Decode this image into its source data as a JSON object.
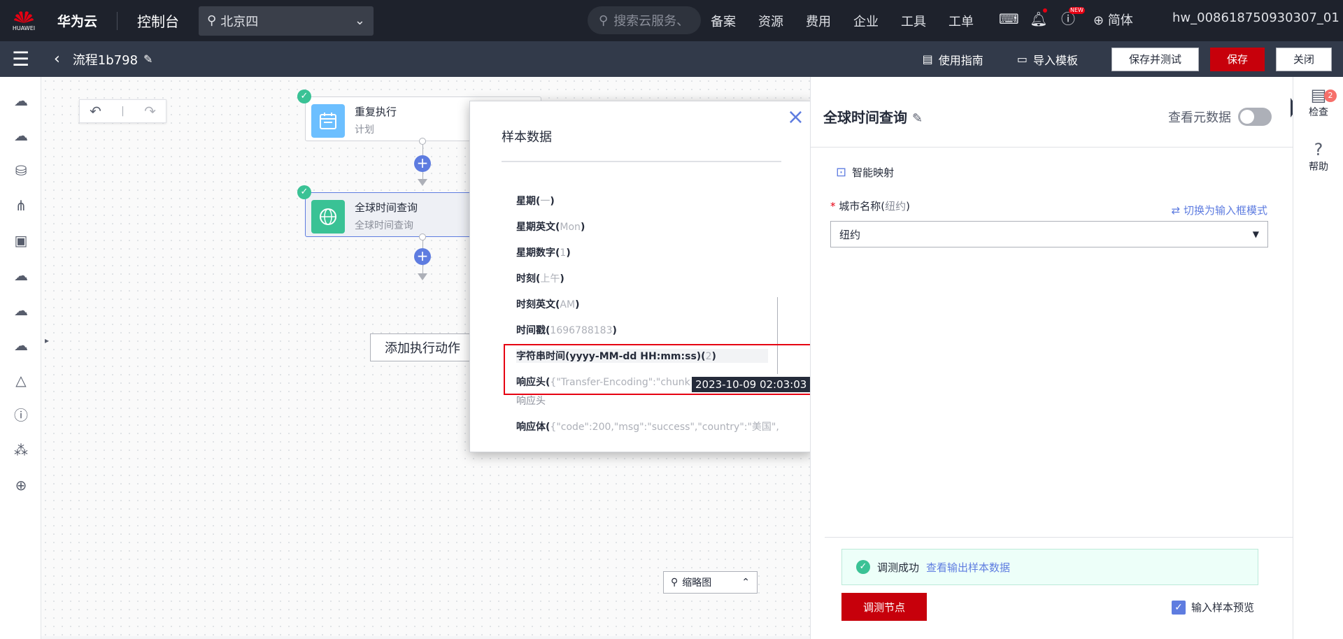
{
  "topbar": {
    "brand": "华为云",
    "logo_text": "HUAWEI",
    "console": "控制台",
    "region": "北京四",
    "search_placeholder": "搜索云服务、",
    "nav": [
      "备案",
      "资源",
      "费用",
      "企业",
      "工具",
      "工单"
    ],
    "new_badge": "NEW",
    "lang": "简体",
    "user": "hw_008618750930307_01"
  },
  "subbar": {
    "flow_title": "流程1b798",
    "guide": "使用指南",
    "import": "导入模板",
    "save_test": "保存并测试",
    "save": "保存",
    "close": "关闭"
  },
  "canvas": {
    "node1": {
      "title": "重复执行",
      "subtitle": "计划"
    },
    "node2": {
      "title": "全球时间查询",
      "subtitle": "全球时间查询"
    },
    "add_action": "添加执行动作",
    "minimap": "缩略图"
  },
  "popup": {
    "title": "样本数据",
    "rows": [
      {
        "label": "星期(",
        "sample": "一",
        "end": ")"
      },
      {
        "label": "星期英文(",
        "sample": "Mon",
        "end": ")"
      },
      {
        "label": "星期数字(",
        "sample": "1",
        "end": ")"
      },
      {
        "label": "时刻(",
        "sample": "上午",
        "end": ")"
      },
      {
        "label": "时刻英文(",
        "sample": "AM",
        "end": ")"
      },
      {
        "label": "时间戳(",
        "sample": "1696788183",
        "end": ")"
      },
      {
        "label": "字符串时间(yyyy-MM-dd HH:mm:ss)(",
        "sample": "2",
        "end": ")"
      },
      {
        "label": "响应头(",
        "sample": "{\"Transfer-Encoding\":\"chunk",
        "end": ""
      },
      {
        "label": "响应体(",
        "sample": "{\"code\":200,\"msg\":\"success\",\"country\":\"美国\",",
        "end": ""
      }
    ],
    "sub_label": "响应头",
    "tooltip": "2023-10-09 02:03:03"
  },
  "panel": {
    "title": "全球时间查询",
    "metadata_label": "查看元数据",
    "smart_mapping": "智能映射",
    "field_label": "城市名称(",
    "field_hint": "纽约",
    "field_label_end": ")",
    "switch_mode": "切换为输入框模式",
    "field_value": "纽约",
    "success_text": "调测成功",
    "view_output": "查看输出样本数据",
    "debug_button": "调测节点",
    "preview_label": "输入样本预览"
  },
  "rightrail": {
    "check": "检查",
    "check_badge": "2",
    "help": "帮助"
  }
}
